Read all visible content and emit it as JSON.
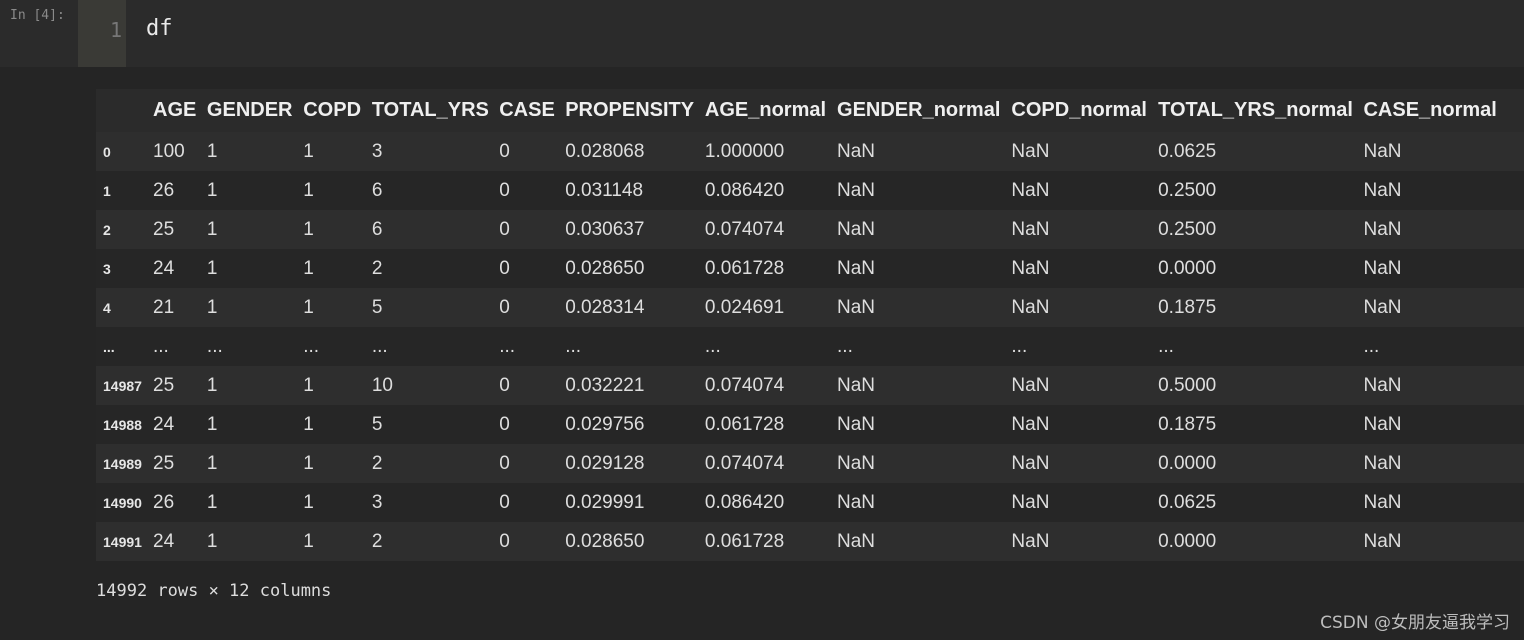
{
  "cell": {
    "prompt": "In [4]:",
    "line_number": "1",
    "code": "df"
  },
  "table": {
    "columns": [
      "",
      "AGE",
      "GENDER",
      "COPD",
      "TOTAL_YRS",
      "CASE",
      "PROPENSITY",
      "AGE_normal",
      "GENDER_normal",
      "COPD_normal",
      "TOTAL_YRS_normal",
      "CASE_normal",
      ""
    ],
    "rows": [
      [
        "0",
        "100",
        "1",
        "1",
        "3",
        "0",
        "0.028068",
        "1.000000",
        "NaN",
        "NaN",
        "0.0625",
        "NaN",
        ""
      ],
      [
        "1",
        "26",
        "1",
        "1",
        "6",
        "0",
        "0.031148",
        "0.086420",
        "NaN",
        "NaN",
        "0.2500",
        "NaN",
        ""
      ],
      [
        "2",
        "25",
        "1",
        "1",
        "6",
        "0",
        "0.030637",
        "0.074074",
        "NaN",
        "NaN",
        "0.2500",
        "NaN",
        ""
      ],
      [
        "3",
        "24",
        "1",
        "1",
        "2",
        "0",
        "0.028650",
        "0.061728",
        "NaN",
        "NaN",
        "0.0000",
        "NaN",
        ""
      ],
      [
        "4",
        "21",
        "1",
        "1",
        "5",
        "0",
        "0.028314",
        "0.024691",
        "NaN",
        "NaN",
        "0.1875",
        "NaN",
        ""
      ],
      [
        "...",
        "...",
        "...",
        "...",
        "...",
        "...",
        "...",
        "...",
        "...",
        "...",
        "...",
        "...",
        ""
      ],
      [
        "14987",
        "25",
        "1",
        "1",
        "10",
        "0",
        "0.032221",
        "0.074074",
        "NaN",
        "NaN",
        "0.5000",
        "NaN",
        ""
      ],
      [
        "14988",
        "24",
        "1",
        "1",
        "5",
        "0",
        "0.029756",
        "0.061728",
        "NaN",
        "NaN",
        "0.1875",
        "NaN",
        ""
      ],
      [
        "14989",
        "25",
        "1",
        "1",
        "2",
        "0",
        "0.029128",
        "0.074074",
        "NaN",
        "NaN",
        "0.0000",
        "NaN",
        ""
      ],
      [
        "14990",
        "26",
        "1",
        "1",
        "3",
        "0",
        "0.029991",
        "0.086420",
        "NaN",
        "NaN",
        "0.0625",
        "NaN",
        ""
      ],
      [
        "14991",
        "24",
        "1",
        "1",
        "2",
        "0",
        "0.028650",
        "0.061728",
        "NaN",
        "NaN",
        "0.0000",
        "NaN",
        ""
      ]
    ]
  },
  "output": {
    "shape_info": "14992 rows × 12 columns"
  },
  "watermark": "CSDN @女朋友逼我学习"
}
